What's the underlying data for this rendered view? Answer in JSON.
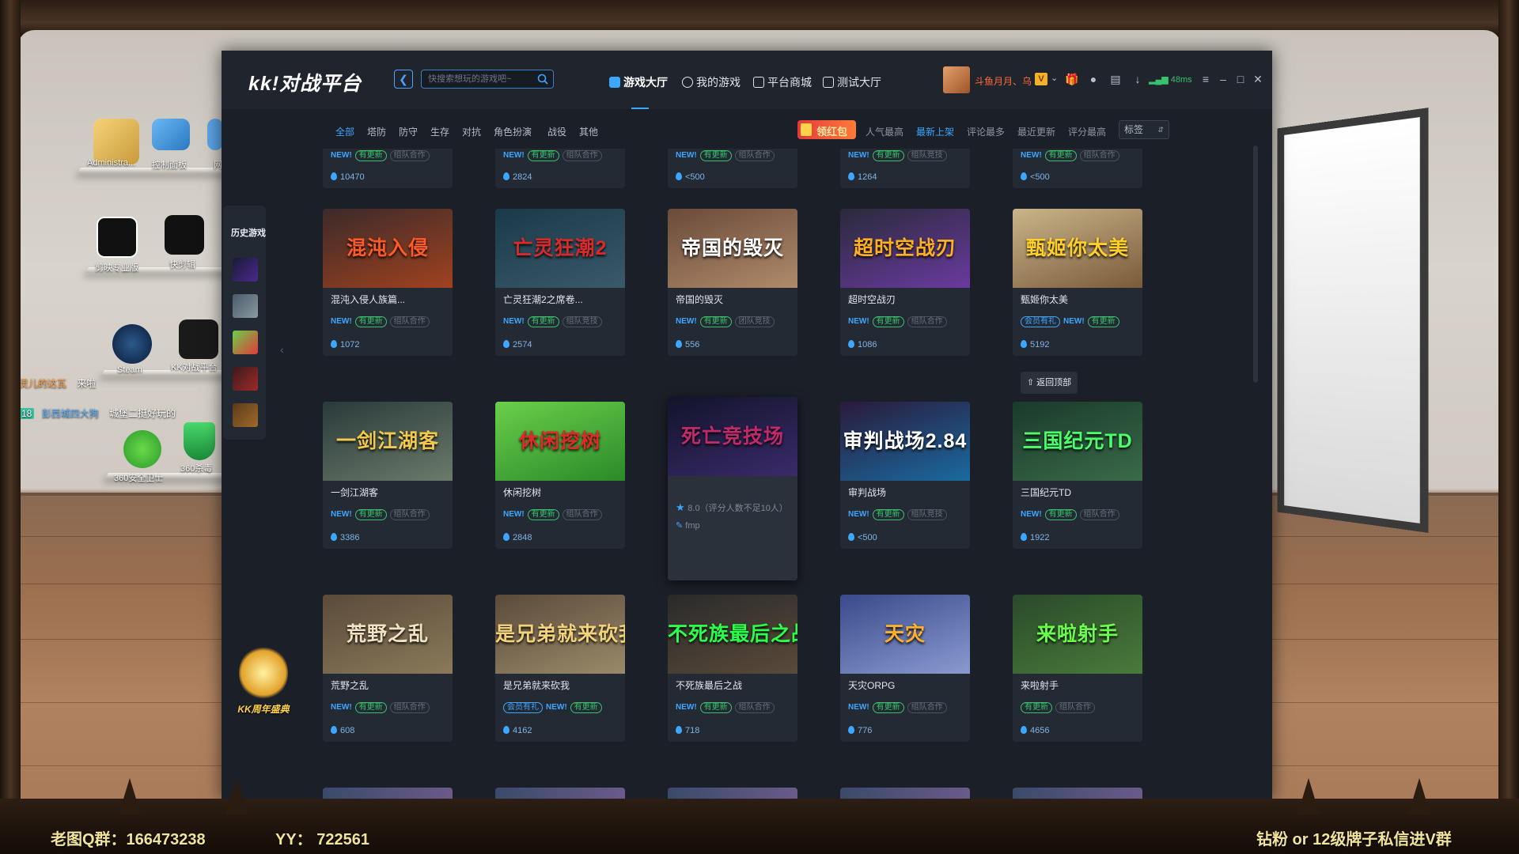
{
  "desktop": {
    "icons": [
      {
        "label": "Administra...",
        "icon": "user-folder-icon"
      },
      {
        "label": "控制面板",
        "icon": "control-panel-icon"
      },
      {
        "label": "网",
        "icon": "network-icon"
      },
      {
        "label": "剪映专业版",
        "icon": "capcut-icon"
      },
      {
        "label": "快剪辑",
        "icon": "kuaijianji-icon"
      },
      {
        "label": "Steam",
        "icon": "steam-icon"
      },
      {
        "label": "KK对战平台",
        "icon": "kk-platform-icon"
      },
      {
        "label": "360安全卫士",
        "icon": "360-safe-icon"
      },
      {
        "label": "360杀毒",
        "icon": "360-antivirus-icon"
      }
    ],
    "chat": [
      {
        "user": "灵儿的达瓦",
        "text": "来啦"
      },
      {
        "user": "彭西城四大狗",
        "text": "城堡二挺好玩的",
        "level": "18"
      }
    ]
  },
  "stream_footer": {
    "qq_group": "老图Q群：166473238",
    "yy": "YY：  722561",
    "promo": "钻粉 or 12级牌子私信进V群"
  },
  "app": {
    "logo": "kk!对战平台",
    "search_placeholder": "快搜索想玩的游戏吧~",
    "nav_tabs": [
      {
        "label": "游戏大厅",
        "active": true,
        "icon": "home-icon"
      },
      {
        "label": "我的游戏",
        "active": false,
        "icon": "gamepad-icon"
      },
      {
        "label": "平台商城",
        "active": false,
        "icon": "cart-icon"
      },
      {
        "label": "测试大厅",
        "active": false,
        "icon": "test-icon"
      }
    ],
    "user": {
      "name": "斗鱼月月、乌",
      "vip": "V",
      "ping": "48ms"
    },
    "categories": [
      "全部",
      "塔防",
      "防守",
      "生存",
      "对抗",
      "角色扮演",
      "战役",
      "其他"
    ],
    "active_category": "全部",
    "red_packet": "领红包",
    "sorts": [
      "人气最高",
      "最新上架",
      "评论最多",
      "最近更新",
      "评分最高"
    ],
    "active_sort": "最新上架",
    "tag_select": "标签",
    "history_title": "历史游戏",
    "festival": "KK周年盛典",
    "back_to_top": "返回顶部",
    "badge_labels": {
      "new": "NEW!",
      "updated": "有更新",
      "vip": "会员有礼"
    },
    "partial_row": [
      {
        "tag": "组队合作",
        "heat": "10470"
      },
      {
        "tag": "组队合作",
        "heat": "2824"
      },
      {
        "tag": "组队合作",
        "heat": "<500"
      },
      {
        "tag": "组队竞技",
        "heat": "1264"
      },
      {
        "tag": "组队合作",
        "heat": "<500"
      }
    ],
    "games": [
      {
        "name": "混沌入侵人族篇...",
        "title_art": "混沌入侵",
        "new": true,
        "vip": false,
        "tag": "组队合作",
        "heat": "1072",
        "colors": [
          "#3b2a2a",
          "#a0421f"
        ],
        "text_color": "#ff5a2a"
      },
      {
        "name": "亡灵狂潮2之席卷...",
        "title_art": "亡灵狂潮2",
        "new": true,
        "vip": false,
        "tag": "组队竞技",
        "heat": "2574",
        "colors": [
          "#1a3a4a",
          "#3a5a6a"
        ],
        "text_color": "#d82a2a"
      },
      {
        "name": "帝国的毁灭",
        "title_art": "帝国的毁灭",
        "new": true,
        "vip": false,
        "tag": "团队竞技",
        "heat": "556",
        "colors": [
          "#6a4a3a",
          "#b08a6a"
        ],
        "text_color": "#ffffff"
      },
      {
        "name": "超时空战刃",
        "title_art": "超时空战刃",
        "new": true,
        "vip": false,
        "tag": "组队合作",
        "heat": "1086",
        "colors": [
          "#2a2a3a",
          "#6a3aa0"
        ],
        "text_color": "#ffb020"
      },
      {
        "name": "甄姬你太美",
        "title_art": "甄姬你太美",
        "new": true,
        "vip": true,
        "tag": "",
        "heat": "5192",
        "colors": [
          "#c9b58a",
          "#7a5a3a"
        ],
        "text_color": "#ffcf2a"
      },
      {
        "name": "一剑江湖客",
        "title_art": "一剑江湖客",
        "new": true,
        "vip": false,
        "tag": "组队合作",
        "heat": "3386",
        "colors": [
          "#2a3a3a",
          "#6a7a6a"
        ],
        "text_color": "#f2c94c"
      },
      {
        "name": "休闲挖树",
        "title_art": "休闲挖树",
        "new": true,
        "vip": false,
        "tag": "组队合作",
        "heat": "2848",
        "colors": [
          "#6acf4a",
          "#2a8a2a"
        ],
        "text_color": "#e02a2a"
      },
      {
        "name": "死亡竞技场",
        "title_art": "死亡竞技场",
        "hover": true,
        "rating": "8.0（评分人数不足10人）",
        "author": "fmp",
        "colors": [
          "#12142a",
          "#3a2a6a"
        ],
        "text_color": "#c02a6a"
      },
      {
        "name": "审判战场",
        "title_art": "审判战场2.84",
        "new": true,
        "vip": false,
        "tag": "组队竞技",
        "heat": "<500",
        "colors": [
          "#2a1a3a",
          "#1a6aa0"
        ],
        "text_color": "#ffffff"
      },
      {
        "name": "三国纪元TD",
        "title_art": "三国纪元TD",
        "new": true,
        "vip": false,
        "tag": "组队合作",
        "heat": "1922",
        "colors": [
          "#1a3a2a",
          "#3a6a4a"
        ],
        "text_color": "#4aff6a"
      },
      {
        "name": "荒野之乱",
        "title_art": "荒野之乱",
        "new": true,
        "vip": false,
        "tag": "组队合作",
        "heat": "608",
        "colors": [
          "#5a4a3a",
          "#8a7a5a"
        ],
        "text_color": "#f2e2c2"
      },
      {
        "name": "是兄弟就来砍我",
        "title_art": "是兄弟就来砍我",
        "new": true,
        "vip": true,
        "tag": "",
        "heat": "4162",
        "colors": [
          "#5a4a3a",
          "#9a8a6a"
        ],
        "text_color": "#f2d27a"
      },
      {
        "name": "不死族最后之战",
        "title_art": "不死族最后之战",
        "new": true,
        "vip": false,
        "tag": "组队合作",
        "heat": "718",
        "colors": [
          "#2a2a2a",
          "#5a4a3a"
        ],
        "text_color": "#2aff4a"
      },
      {
        "name": "天灾ORPG",
        "title_art": "天灾",
        "new": true,
        "vip": false,
        "tag": "组队合作",
        "heat": "776",
        "colors": [
          "#3a4a8a",
          "#8a9ad0"
        ],
        "text_color": "#ffb02a"
      },
      {
        "name": "来啦射手",
        "title_art": "来啦射手",
        "new": false,
        "vip": false,
        "tag": "组队合作",
        "heat": "4656",
        "colors": [
          "#2a4a2a",
          "#4a7a3a"
        ],
        "text_color": "#6aff4a"
      }
    ]
  }
}
